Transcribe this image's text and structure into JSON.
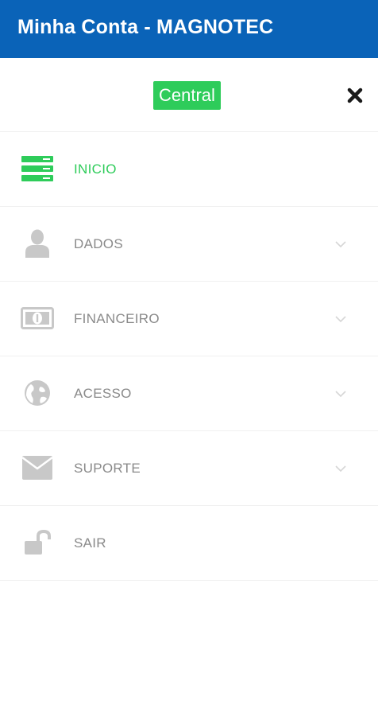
{
  "app_bar": {
    "title": "Minha Conta - MAGNOTEC"
  },
  "drawer": {
    "badge": "Central",
    "close_icon": "close-icon"
  },
  "menu": {
    "items": [
      {
        "label": "INICIO",
        "icon": "server-icon",
        "active": true,
        "expandable": false
      },
      {
        "label": "DADOS",
        "icon": "user-icon",
        "active": false,
        "expandable": true
      },
      {
        "label": "FINANCEIRO",
        "icon": "money-icon",
        "active": false,
        "expandable": true
      },
      {
        "label": "ACESSO",
        "icon": "globe-icon",
        "active": false,
        "expandable": true
      },
      {
        "label": "SUPORTE",
        "icon": "envelope-icon",
        "active": false,
        "expandable": true
      },
      {
        "label": "SAIR",
        "icon": "unlock-icon",
        "active": false,
        "expandable": false
      }
    ]
  },
  "colors": {
    "app_bar": "#0a63b8",
    "accent": "#2ecc5a",
    "icon_gray": "#c8c8c8",
    "label_gray": "#8a8a8a"
  }
}
